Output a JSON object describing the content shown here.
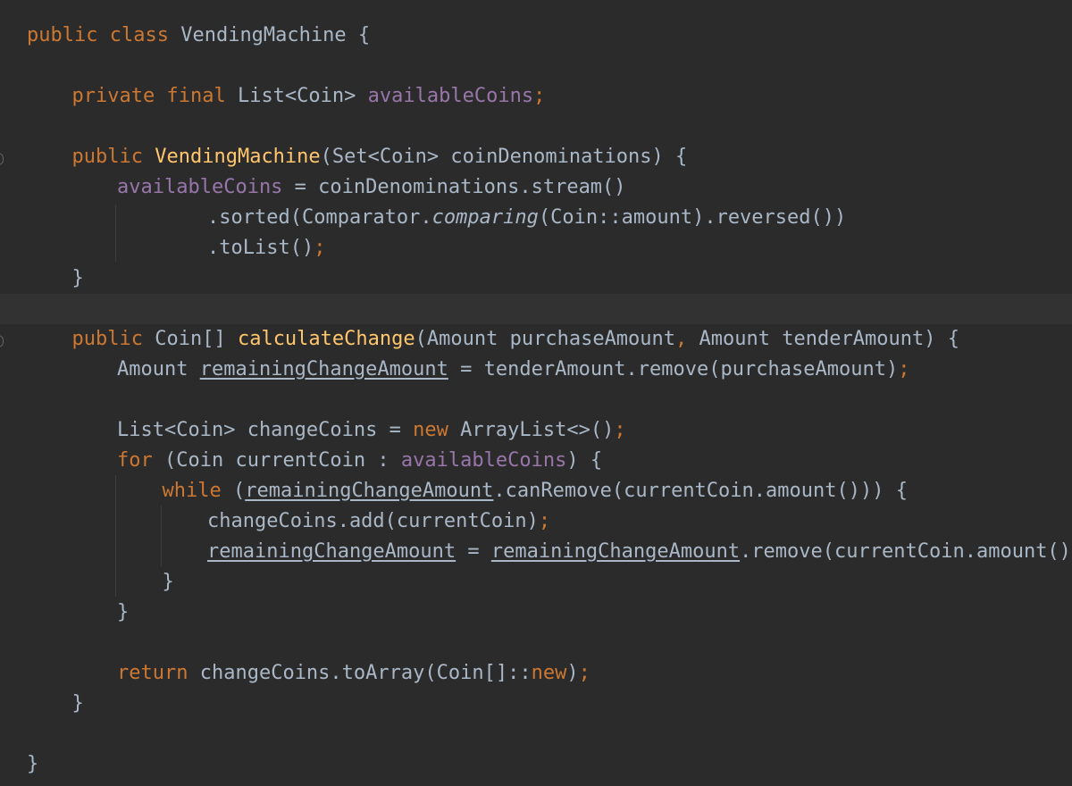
{
  "editor": {
    "theme_colors": {
      "background": "#2b2b2b",
      "caret_row": "#323232",
      "default": "#a9b7c6",
      "keyword": "#cc7832",
      "field": "#9876aa",
      "method_declaration": "#ffc66d"
    },
    "lines": [
      {
        "indent": 0,
        "tokens": [
          {
            "t": "public",
            "k": "kw"
          },
          {
            "t": " "
          },
          {
            "t": "class",
            "k": "kw"
          },
          {
            "t": " VendingMachine {"
          }
        ]
      },
      {
        "indent": 1,
        "tokens": [
          {
            "t": "private",
            "k": "kw"
          },
          {
            "t": " "
          },
          {
            "t": "final",
            "k": "kw"
          },
          {
            "t": " List<Coin> "
          },
          {
            "t": "availableCoins",
            "k": "field"
          },
          {
            "t": ";",
            "k": "kw"
          }
        ]
      },
      {
        "indent": 1,
        "tokens": [
          {
            "t": "public",
            "k": "kw"
          },
          {
            "t": " "
          },
          {
            "t": "VendingMachine",
            "k": "method"
          },
          {
            "t": "(Set<Coin> coinDenominations) {"
          }
        ]
      },
      {
        "indent": 2,
        "tokens": [
          {
            "t": "availableCoins",
            "k": "field"
          },
          {
            "t": " = coinDenominations.stream()"
          }
        ]
      },
      {
        "indent": 4,
        "tokens": [
          {
            "t": ".sorted(Comparator."
          },
          {
            "t": "comparing",
            "k": "italic"
          },
          {
            "t": "(Coin::amount).reversed())"
          }
        ]
      },
      {
        "indent": 4,
        "tokens": [
          {
            "t": ".toList()"
          },
          {
            "t": ";",
            "k": "kw"
          }
        ]
      },
      {
        "indent": 1,
        "tokens": [
          {
            "t": "}"
          }
        ]
      },
      {
        "indent": 1,
        "tokens": [
          {
            "t": "public",
            "k": "kw"
          },
          {
            "t": " Coin[] "
          },
          {
            "t": "calculateChange",
            "k": "method"
          },
          {
            "t": "(Amount purchaseAmount"
          },
          {
            "t": ",",
            "k": "kw"
          },
          {
            "t": " Amount tenderAmount) {"
          }
        ]
      },
      {
        "indent": 2,
        "tokens": [
          {
            "t": "Amount "
          },
          {
            "t": "remainingChangeAmount",
            "k": "ul"
          },
          {
            "t": " = tenderAmount.remove(purchaseAmount)"
          },
          {
            "t": ";",
            "k": "kw"
          }
        ]
      },
      {
        "indent": 2,
        "tokens": [
          {
            "t": "List<Coin> changeCoins = "
          },
          {
            "t": "new",
            "k": "kw"
          },
          {
            "t": " ArrayList<>()"
          },
          {
            "t": ";",
            "k": "kw"
          }
        ]
      },
      {
        "indent": 2,
        "tokens": [
          {
            "t": "for",
            "k": "kw"
          },
          {
            "t": " (Coin currentCoin : "
          },
          {
            "t": "availableCoins",
            "k": "field"
          },
          {
            "t": ") {"
          }
        ]
      },
      {
        "indent": 3,
        "tokens": [
          {
            "t": "while",
            "k": "kw"
          },
          {
            "t": " ("
          },
          {
            "t": "remainingChangeAmount",
            "k": "ul"
          },
          {
            "t": ".canRemove(currentCoin.amount())) {"
          }
        ]
      },
      {
        "indent": 4,
        "tokens": [
          {
            "t": "changeCoins.add(currentCoin)"
          },
          {
            "t": ";",
            "k": "kw"
          }
        ]
      },
      {
        "indent": 4,
        "tokens": [
          {
            "t": "remainingChangeAmount",
            "k": "ul"
          },
          {
            "t": " = "
          },
          {
            "t": "remainingChangeAmount",
            "k": "ul"
          },
          {
            "t": ".remove(currentCoin.amount())"
          },
          {
            "t": ";",
            "k": "kw"
          }
        ]
      },
      {
        "indent": 3,
        "tokens": [
          {
            "t": "}"
          }
        ]
      },
      {
        "indent": 2,
        "tokens": [
          {
            "t": "}"
          }
        ]
      },
      {
        "indent": 2,
        "tokens": [
          {
            "t": "return",
            "k": "kw"
          },
          {
            "t": " changeCoins.toArray(Coin[]::"
          },
          {
            "t": "new",
            "k": "kw"
          },
          {
            "t": ")"
          },
          {
            "t": ";",
            "k": "kw"
          }
        ]
      },
      {
        "indent": 1,
        "tokens": [
          {
            "t": "}"
          }
        ]
      },
      {
        "indent": 0,
        "tokens": [
          {
            "t": "}"
          }
        ]
      }
    ]
  }
}
